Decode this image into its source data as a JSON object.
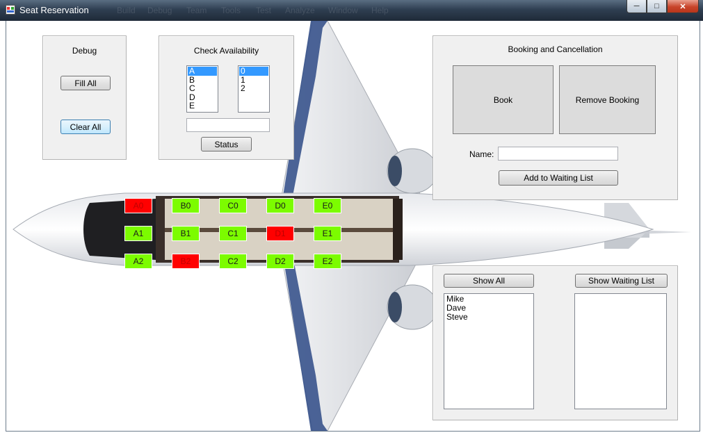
{
  "window": {
    "title": "Seat Reservation",
    "menu_ghost": [
      "Build",
      "Debug",
      "Team",
      "Tools",
      "Test",
      "Analyze",
      "Window",
      "Help"
    ]
  },
  "debug": {
    "label": "Debug",
    "fill_all": "Fill All",
    "clear_all": "Clear All"
  },
  "availability": {
    "label": "Check Availability",
    "rows": [
      "A",
      "B",
      "C",
      "D",
      "E"
    ],
    "cols": [
      "0",
      "1",
      "2"
    ],
    "selected_row": "A",
    "selected_col": "0",
    "status_value": "",
    "status_button": "Status"
  },
  "booking": {
    "label": "Booking and Cancellation",
    "book": "Book",
    "remove": "Remove Booking",
    "name_label": "Name:",
    "name_value": "",
    "waiting": "Add to Waiting List"
  },
  "lists": {
    "show_all": "Show All",
    "show_waiting": "Show Waiting List",
    "all_items": [
      "Mike",
      "Dave",
      "Steve"
    ],
    "waiting_items": []
  },
  "seats": [
    {
      "id": "A0",
      "status": "taken"
    },
    {
      "id": "A1",
      "status": "free"
    },
    {
      "id": "A2",
      "status": "free"
    },
    {
      "id": "B0",
      "status": "free"
    },
    {
      "id": "B1",
      "status": "free"
    },
    {
      "id": "B2",
      "status": "taken"
    },
    {
      "id": "C0",
      "status": "free"
    },
    {
      "id": "C1",
      "status": "free"
    },
    {
      "id": "C2",
      "status": "free"
    },
    {
      "id": "D0",
      "status": "free"
    },
    {
      "id": "D1",
      "status": "taken"
    },
    {
      "id": "D2",
      "status": "free"
    },
    {
      "id": "E0",
      "status": "free"
    },
    {
      "id": "E1",
      "status": "free"
    },
    {
      "id": "E2",
      "status": "free"
    }
  ],
  "colors": {
    "free": "#7cfc00",
    "taken": "#ff0000",
    "selection": "#3399ff"
  }
}
